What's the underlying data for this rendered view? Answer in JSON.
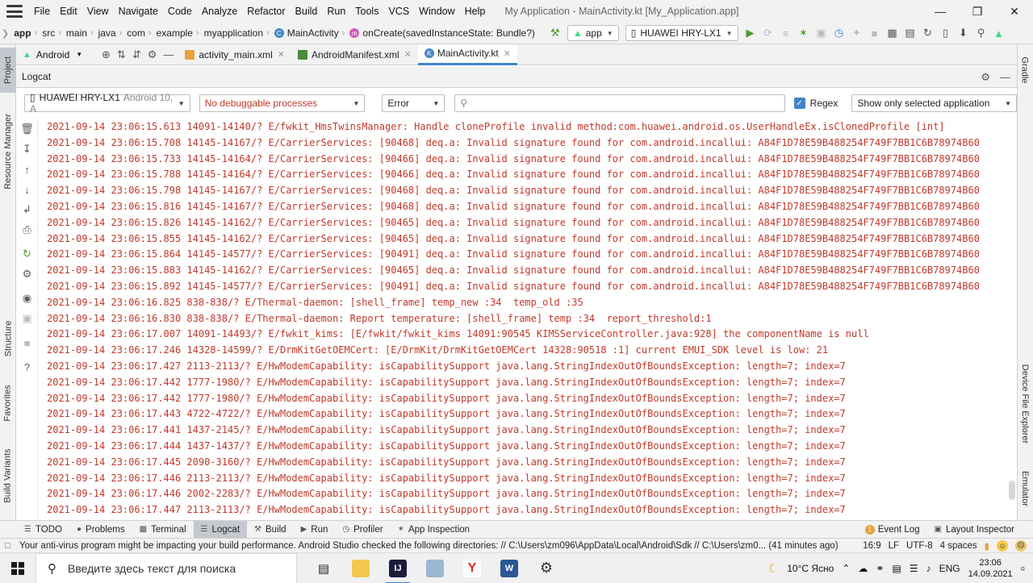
{
  "menubar": {
    "items": [
      {
        "label": "File"
      },
      {
        "label": "Edit"
      },
      {
        "label": "View"
      },
      {
        "label": "Navigate"
      },
      {
        "label": "Code"
      },
      {
        "label": "Analyze"
      },
      {
        "label": "Refactor"
      },
      {
        "label": "Build"
      },
      {
        "label": "Run"
      },
      {
        "label": "Tools"
      },
      {
        "label": "VCS"
      },
      {
        "label": "Window"
      },
      {
        "label": "Help"
      }
    ],
    "window_title": "My Application - MainActivity.kt [My_Application.app]"
  },
  "navbar": {
    "crumbs": [
      "app",
      "src",
      "main",
      "java",
      "com",
      "example",
      "myapplication"
    ],
    "class_crumb": "MainActivity",
    "method_crumb": "onCreate(savedInstanceState: Bundle?)",
    "run_config": "app",
    "device": "HUAWEI HRY-LX1"
  },
  "left_strip": {
    "tabs": [
      "Project",
      "Resource Manager",
      "Structure",
      "Favorites",
      "Build Variants"
    ]
  },
  "right_strip": {
    "tabs": [
      "Gradle",
      "Device File Explorer",
      "Emulator"
    ]
  },
  "project_selector": "Android",
  "editor_tabs": [
    {
      "label": "activity_main.xml",
      "icon": "xml-file-icon"
    },
    {
      "label": "AndroidManifest.xml",
      "icon": "manifest-file-icon"
    },
    {
      "label": "MainActivity.kt",
      "icon": "kotlin-file-icon",
      "active": true
    }
  ],
  "logcat": {
    "title": "Logcat",
    "device_name": "HUAWEI HRY-LX1",
    "device_os": "Android 10, A",
    "process": "No debuggable processes",
    "level": "Error",
    "search_value": "",
    "regex_label": "Regex",
    "regex_checked": true,
    "filter": "Show only selected application",
    "lines": [
      "2021-09-14 23:06:15.613 14091-14140/? E/fwkit_HmsTwinsManager: Handle cloneProfile invalid method:com.huawei.android.os.UserHandleEx.isClonedProfile [int]",
      "2021-09-14 23:06:15.708 14145-14167/? E/CarrierServices: [90468] deq.a: Invalid signature found for com.android.incallui: A84F1D78E59B488254F749F7BB1C6B78974B60",
      "2021-09-14 23:06:15.733 14145-14164/? E/CarrierServices: [90466] deq.a: Invalid signature found for com.android.incallui: A84F1D78E59B488254F749F7BB1C6B78974B60",
      "2021-09-14 23:06:15.788 14145-14164/? E/CarrierServices: [90466] deq.a: Invalid signature found for com.android.incallui: A84F1D78E59B488254F749F7BB1C6B78974B60",
      "2021-09-14 23:06:15.798 14145-14167/? E/CarrierServices: [90468] deq.a: Invalid signature found for com.android.incallui: A84F1D78E59B488254F749F7BB1C6B78974B60",
      "2021-09-14 23:06:15.816 14145-14167/? E/CarrierServices: [90468] deq.a: Invalid signature found for com.android.incallui: A84F1D78E59B488254F749F7BB1C6B78974B60",
      "2021-09-14 23:06:15.826 14145-14162/? E/CarrierServices: [90465] deq.a: Invalid signature found for com.android.incallui: A84F1D78E59B488254F749F7BB1C6B78974B60",
      "2021-09-14 23:06:15.855 14145-14162/? E/CarrierServices: [90465] deq.a: Invalid signature found for com.android.incallui: A84F1D78E59B488254F749F7BB1C6B78974B60",
      "2021-09-14 23:06:15.864 14145-14577/? E/CarrierServices: [90491] deq.a: Invalid signature found for com.android.incallui: A84F1D78E59B488254F749F7BB1C6B78974B60",
      "2021-09-14 23:06:15.883 14145-14162/? E/CarrierServices: [90465] deq.a: Invalid signature found for com.android.incallui: A84F1D78E59B488254F749F7BB1C6B78974B60",
      "2021-09-14 23:06:15.892 14145-14577/? E/CarrierServices: [90491] deq.a: Invalid signature found for com.android.incallui: A84F1D78E59B488254F749F7BB1C6B78974B60",
      "2021-09-14 23:06:16.825 838-838/? E/Thermal-daemon: [shell_frame] temp_new :34  temp_old :35",
      "2021-09-14 23:06:16.830 838-838/? E/Thermal-daemon: Report temperature: [shell_frame] temp :34  report_threshold:1",
      "2021-09-14 23:06:17.007 14091-14493/? E/fwkit_kims: [E/fwkit/fwkit_kims 14091:90545 KIMSServiceController.java:928] the componentName is null",
      "2021-09-14 23:06:17.246 14328-14599/? E/DrmKitGetOEMCert: [E/DrmKit/DrmKitGetOEMCert 14328:90518 :1] current EMUI_SDK level is low: 21",
      "2021-09-14 23:06:17.427 2113-2113/? E/HwModemCapability: isCapabilitySupport java.lang.StringIndexOutOfBoundsException: length=7; index=7",
      "2021-09-14 23:06:17.442 1777-1980/? E/HwModemCapability: isCapabilitySupport java.lang.StringIndexOutOfBoundsException: length=7; index=7",
      "2021-09-14 23:06:17.442 1777-1980/? E/HwModemCapability: isCapabilitySupport java.lang.StringIndexOutOfBoundsException: length=7; index=7",
      "2021-09-14 23:06:17.443 4722-4722/? E/HwModemCapability: isCapabilitySupport java.lang.StringIndexOutOfBoundsException: length=7; index=7",
      "2021-09-14 23:06:17.441 1437-2145/? E/HwModemCapability: isCapabilitySupport java.lang.StringIndexOutOfBoundsException: length=7; index=7",
      "2021-09-14 23:06:17.444 1437-1437/? E/HwModemCapability: isCapabilitySupport java.lang.StringIndexOutOfBoundsException: length=7; index=7",
      "2021-09-14 23:06:17.445 2090-3160/? E/HwModemCapability: isCapabilitySupport java.lang.StringIndexOutOfBoundsException: length=7; index=7",
      "2021-09-14 23:06:17.446 2113-2113/? E/HwModemCapability: isCapabilitySupport java.lang.StringIndexOutOfBoundsException: length=7; index=7",
      "2021-09-14 23:06:17.446 2002-2283/? E/HwModemCapability: isCapabilitySupport java.lang.StringIndexOutOfBoundsException: length=7; index=7",
      "2021-09-14 23:06:17.447 2113-2113/? E/HwModemCapability: isCapabilitySupport java.lang.StringIndexOutOfBoundsException: length=7; index=7"
    ]
  },
  "bottom_tabs": {
    "items": [
      {
        "label": "TODO",
        "icon": "list-icon"
      },
      {
        "label": "Problems",
        "icon": "problems-icon"
      },
      {
        "label": "Terminal",
        "icon": "terminal-icon"
      },
      {
        "label": "Logcat",
        "icon": "logcat-icon",
        "active": true
      },
      {
        "label": "Build",
        "icon": "hammer-icon"
      },
      {
        "label": "Run",
        "icon": "play-icon"
      },
      {
        "label": "Profiler",
        "icon": "gauge-icon"
      },
      {
        "label": "App Inspection",
        "icon": "inspection-icon"
      }
    ],
    "event_log": "Event Log",
    "event_log_count": "1",
    "layout_inspector": "Layout Inspector"
  },
  "statusbar": {
    "message": "Your anti-virus program might be impacting your build performance. Android Studio checked the following directories: // C:\\Users\\zm096\\AppData\\Local\\Android\\Sdk // C:\\Users\\zm0... (41 minutes ago)",
    "position": "16:9",
    "line_sep": "LF",
    "encoding": "UTF-8",
    "indent": "4 spaces"
  },
  "taskbar": {
    "search_placeholder": "Введите здесь текст для поиска",
    "weather": "10°C  Ясно",
    "language": "ENG",
    "time": "23:06",
    "date": "14.09.2021"
  },
  "colors": {
    "log_error": "#c0392b",
    "accent": "#4083c9",
    "chrome": "#f2f2f2"
  }
}
